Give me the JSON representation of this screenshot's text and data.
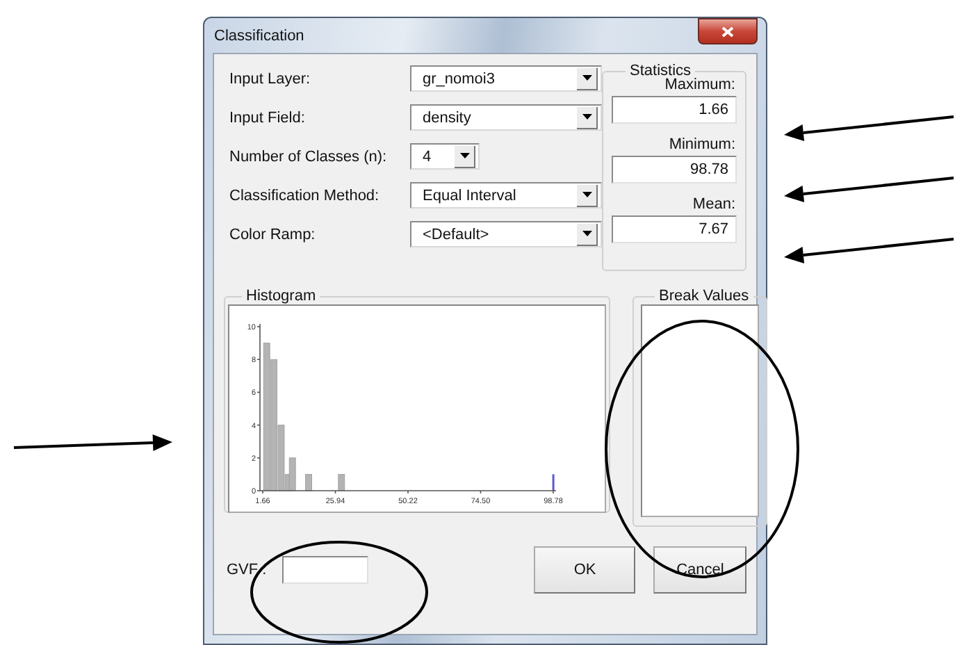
{
  "window": {
    "title": "Classification"
  },
  "fields": [
    {
      "label": "Input Layer:",
      "value": "gr_nomoi3",
      "kind": "wide"
    },
    {
      "label": "Input Field:",
      "value": "density",
      "kind": "wide"
    },
    {
      "label": "Number of Classes (n):",
      "value": "4",
      "kind": "narrow"
    },
    {
      "label": "Classification Method:",
      "value": "Equal Interval",
      "kind": "wide"
    },
    {
      "label": "Color Ramp:",
      "value": "<Default>",
      "kind": "wide"
    }
  ],
  "statistics": {
    "title": "Statistics",
    "items": [
      {
        "label": "Maximum:",
        "value": "1.66"
      },
      {
        "label": "Minimum:",
        "value": "98.78"
      },
      {
        "label": "Mean:",
        "value": "7.67"
      }
    ]
  },
  "histogram": {
    "title": "Histogram",
    "chart_data": {
      "type": "bar",
      "x": [
        3,
        5.4,
        7.8,
        10.2,
        11.6,
        17,
        28,
        98.78
      ],
      "series": [
        {
          "color": "#b4b4b4",
          "values": [
            9,
            8,
            4,
            1,
            2,
            1,
            1,
            null
          ]
        },
        {
          "color": "#5a5ad0",
          "values": [
            null,
            null,
            null,
            null,
            null,
            null,
            null,
            1
          ]
        }
      ],
      "xlim": [
        1.66,
        98.78
      ],
      "ylim": [
        0,
        10
      ],
      "xticks": [
        {
          "value": 1.66,
          "label": "1.66"
        },
        {
          "value": 25.94,
          "label": "25.94"
        },
        {
          "value": 50.22,
          "label": "50.22"
        },
        {
          "value": 74.5,
          "label": "74.50"
        },
        {
          "value": 98.78,
          "label": "98.78"
        }
      ],
      "yticks": [
        0,
        2,
        4,
        6,
        8,
        10
      ]
    }
  },
  "break_values": {
    "title": "Break Values"
  },
  "gvf": {
    "label": "GVF :"
  },
  "buttons": [
    {
      "label": "OK"
    },
    {
      "label": "Cancel"
    }
  ]
}
